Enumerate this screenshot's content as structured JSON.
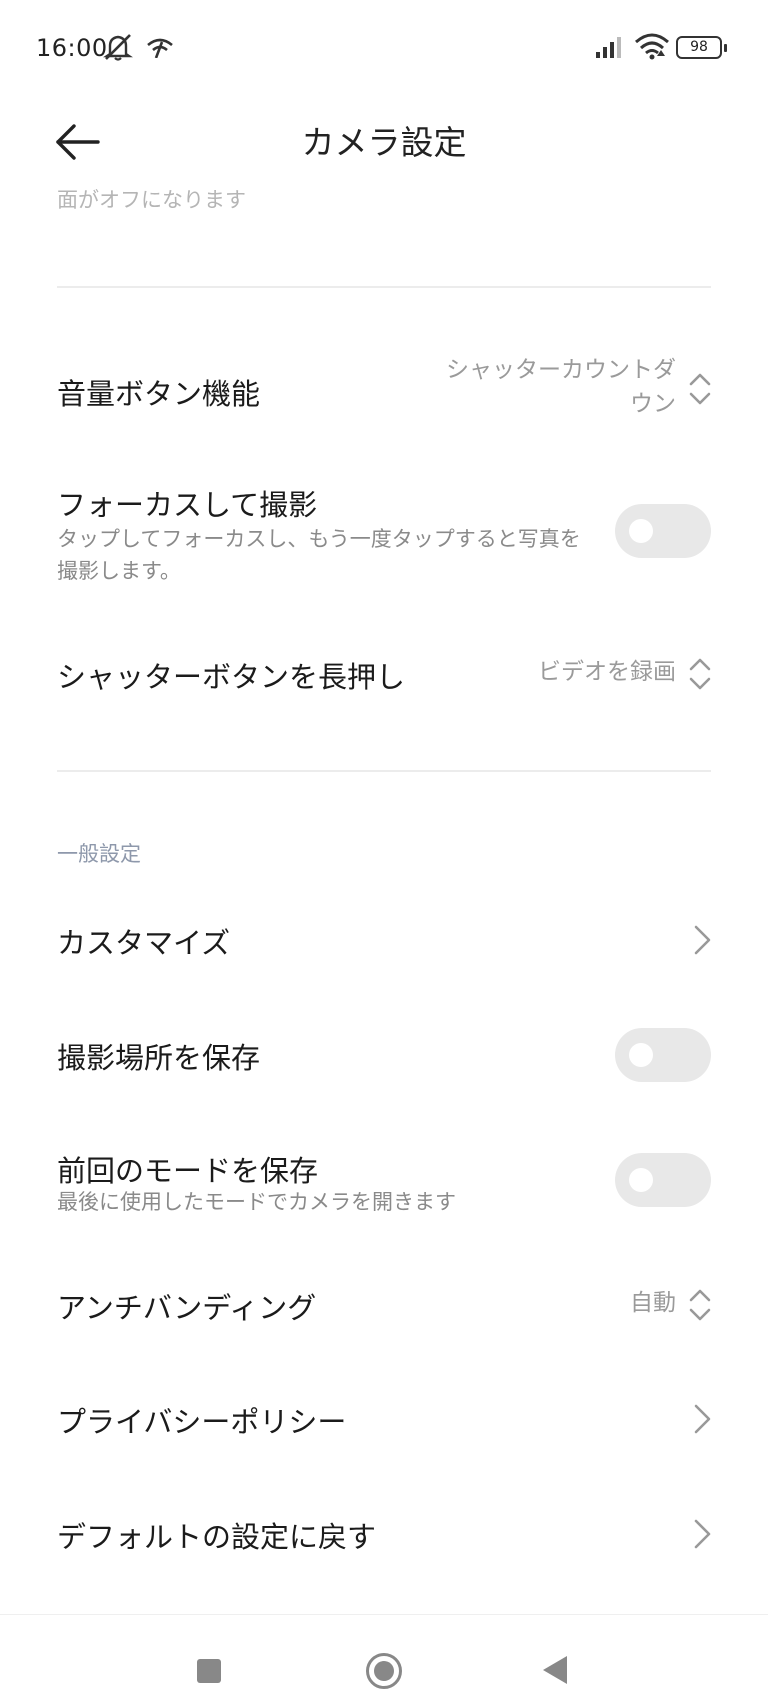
{
  "status": {
    "time": "16:00",
    "battery": "98",
    "icons": [
      "mute-icon",
      "network-icon",
      "signal-icon",
      "wifi-icon",
      "battery-icon"
    ]
  },
  "header": {
    "title": "カメラ設定",
    "back_icon": "arrow-left-icon"
  },
  "faded_subtitle": "面がオフになります",
  "volume_button": {
    "title": "音量ボタン機能",
    "value_line1": "シャッターカウントダ",
    "value_line2": "ウン"
  },
  "focus_shoot": {
    "title": "フォーカスして撮影",
    "subtitle": "タップしてフォーカスし、もう一度タップすると写真を撮影します。",
    "toggle_on": false
  },
  "long_press": {
    "title": "シャッターボタンを長押し",
    "value": "ビデオを録画"
  },
  "general_section": {
    "label": "一般設定",
    "customize": {
      "title": "カスタマイズ"
    },
    "save_location": {
      "title": "撮影場所を保存",
      "toggle_on": false
    },
    "save_last_mode": {
      "title": "前回のモードを保存",
      "subtitle": "最後に使用したモードでカメラを開きます",
      "toggle_on": false
    },
    "anti_banding": {
      "title": "アンチバンディング",
      "value": "自動"
    },
    "privacy_policy": {
      "title": "プライバシーポリシー"
    },
    "reset_defaults": {
      "title": "デフォルトの設定に戻す"
    }
  },
  "colors": {
    "toggle_off_track": "#e8e8e8",
    "section_label": "#8e98ab",
    "secondary_text": "#9a9a9a"
  },
  "nav_icons": [
    "recents-square-icon",
    "home-circle-icon",
    "back-triangle-icon"
  ]
}
